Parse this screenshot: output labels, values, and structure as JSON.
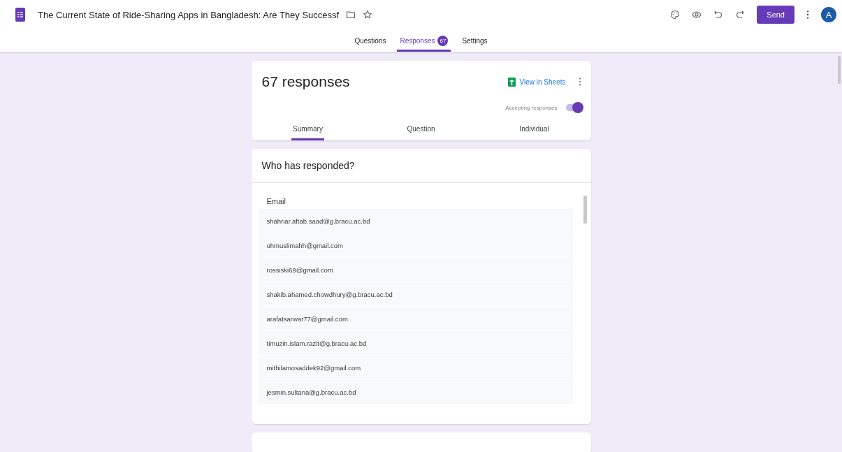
{
  "header": {
    "title": "The Current State of Ride-Sharing Apps in Bangladesh: Are They Successf",
    "send": "Send",
    "avatar": "A"
  },
  "tabs": [
    {
      "label": "Questions",
      "selected": false
    },
    {
      "label": "Responses",
      "selected": true,
      "badge": "67"
    },
    {
      "label": "Settings",
      "selected": false
    }
  ],
  "summary": {
    "count": "67 responses",
    "view_in_sheets": "View in Sheets",
    "accepting_label": "Accepting responses",
    "accepting": true,
    "tabs": [
      {
        "label": "Summary",
        "selected": true
      },
      {
        "label": "Question",
        "selected": false
      },
      {
        "label": "Individual",
        "selected": false
      }
    ]
  },
  "respondents": {
    "title": "Who has responded?",
    "column": "Email",
    "emails": [
      "shahriar.aftab.saad@g.bracu.ac.bd",
      "ohmuslimahh@gmail.com",
      "rossiski69@gmail.com",
      "shakib.ahamed.chowdhury@g.bracu.ac.bd",
      "arafatsarwar77@gmail.com",
      "timuzin.islam.razit@g.bracu.ac.bd",
      "mithilamosaddek92@gmail.com",
      "jesmin.sultana@g.bracu.ac.bd"
    ]
  }
}
